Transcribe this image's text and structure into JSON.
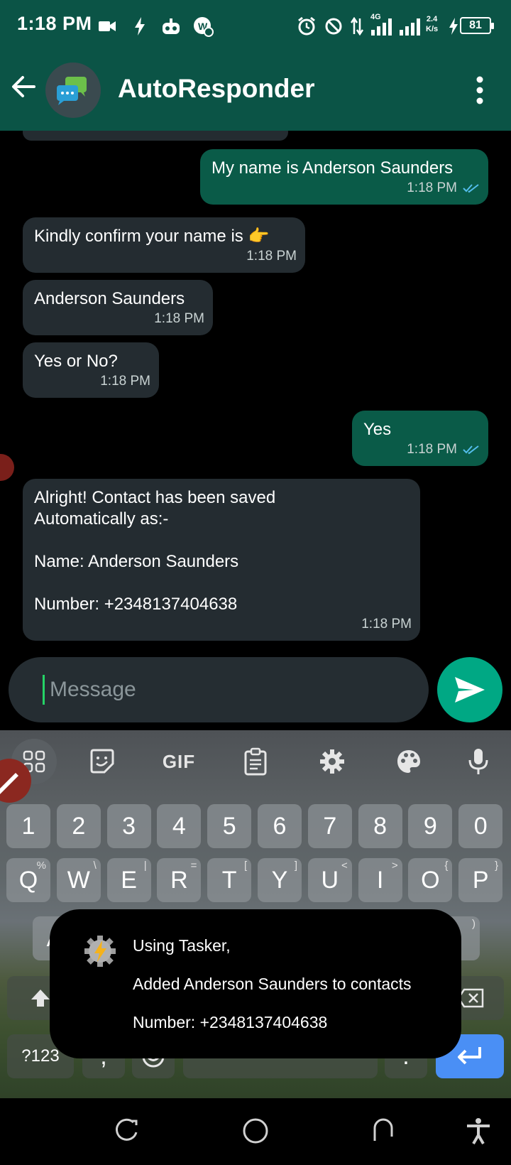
{
  "status_bar": {
    "time": "1:18 PM",
    "network_label": "4G",
    "speed_value": "2.4",
    "speed_unit": "K/s",
    "battery": "81",
    "icons": [
      "video-icon",
      "flash-icon",
      "robot-icon",
      "app-badge-icon",
      "alarm-icon",
      "dnd-icon",
      "data-arrows-icon",
      "signal-icon",
      "signal-icon",
      "charging-icon"
    ]
  },
  "header": {
    "title": "AutoResponder"
  },
  "chat": {
    "messages": [
      {
        "direction": "out",
        "text": "My name is Anderson Saunders",
        "time": "1:18 PM",
        "read": true
      },
      {
        "direction": "in",
        "text": "Kindly confirm your name is 👉",
        "time": "1:18 PM"
      },
      {
        "direction": "in",
        "text": "Anderson Saunders",
        "time": "1:18 PM"
      },
      {
        "direction": "in",
        "text": "Yes or No?",
        "time": "1:18 PM"
      },
      {
        "direction": "out",
        "text": "Yes",
        "time": "1:18 PM",
        "read": true
      },
      {
        "direction": "in",
        "text": "Alright! Contact has been saved\nAutomatically as:-\n\nName: Anderson Saunders\n\nNumber: +2348137404638",
        "time": "1:18 PM"
      }
    ]
  },
  "composer": {
    "placeholder": "Message"
  },
  "keyboard": {
    "toolbar_gif": "GIF",
    "numbers": [
      "1",
      "2",
      "3",
      "4",
      "5",
      "6",
      "7",
      "8",
      "9",
      "0"
    ],
    "row1": [
      "Q",
      "W",
      "E",
      "R",
      "T",
      "Y",
      "U",
      "I",
      "O",
      "P"
    ],
    "row1_alts": [
      "%",
      "\\",
      "|",
      "=",
      "[",
      "]",
      "<",
      ">",
      "{",
      "}"
    ],
    "row2_partial": [
      "A",
      ")"
    ],
    "symbols_key": "?123",
    "comma_key": ",",
    "period_key": "."
  },
  "toast": {
    "line1": "Using Tasker,",
    "line2": "Added Anderson Saunders to contacts",
    "line3": "Number: +2348137404638"
  },
  "colors": {
    "header_bg": "#0b5446",
    "incoming_bubble": "#242c31",
    "outgoing_bubble": "#0a5b48",
    "send_button": "#00a884",
    "read_ticks": "#53bdeb"
  }
}
